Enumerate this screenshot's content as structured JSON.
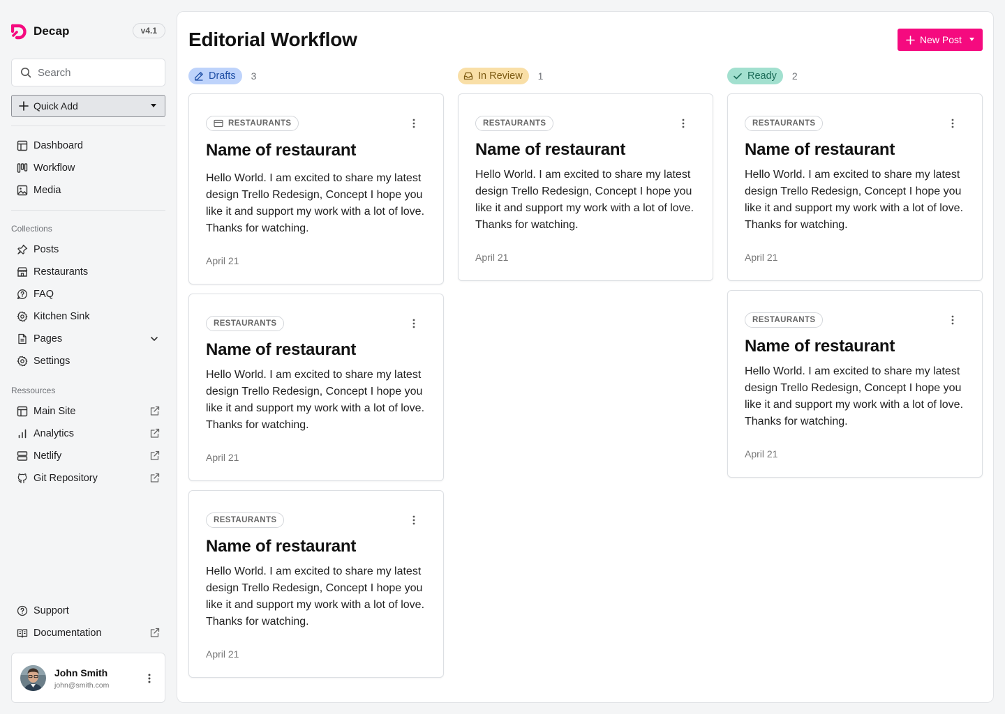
{
  "app": {
    "name": "Decap",
    "version": "v4.1"
  },
  "search": {
    "placeholder": "Search"
  },
  "quick_add": {
    "label": "Quick Add"
  },
  "nav": [
    {
      "label": "Dashboard",
      "icon": "dashboard-icon"
    },
    {
      "label": "Workflow",
      "icon": "workflow-icon"
    },
    {
      "label": "Media",
      "icon": "media-icon"
    }
  ],
  "collections": {
    "label": "Collections",
    "items": [
      {
        "label": "Posts",
        "icon": "pin-icon"
      },
      {
        "label": "Restaurants",
        "icon": "store-icon"
      },
      {
        "label": "FAQ",
        "icon": "faq-icon"
      },
      {
        "label": "Kitchen Sink",
        "icon": "gear-icon"
      },
      {
        "label": "Pages",
        "icon": "page-icon"
      },
      {
        "label": "Settings",
        "icon": "gear-icon"
      }
    ]
  },
  "resources": {
    "label": "Ressources",
    "items": [
      {
        "label": "Main Site",
        "icon": "layout-icon"
      },
      {
        "label": "Analytics",
        "icon": "analytics-icon"
      },
      {
        "label": "Netlify",
        "icon": "server-icon"
      },
      {
        "label": "Git Repository",
        "icon": "github-icon"
      }
    ]
  },
  "footer_nav": [
    {
      "label": "Support",
      "icon": "help-icon"
    },
    {
      "label": "Documentation",
      "icon": "book-icon"
    }
  ],
  "user": {
    "name": "John Smith",
    "email": "john@smith.com"
  },
  "page": {
    "title": "Editorial Workflow",
    "new_post_label": "New Post"
  },
  "columns": [
    {
      "label": "Drafts",
      "count": "3",
      "color": "#bed3fb",
      "cards": [
        {
          "tag": "RESTAURANTS",
          "title": "Name of restaurant",
          "body": "Hello World. I am excited to share my latest design Trello Redesign, Concept I hope you like it and support my work with a lot of love. Thanks for watching.",
          "date": "April 21"
        },
        {
          "tag": "RESTAURANTS",
          "title": "Name of restaurant",
          "body": "Hello World. I am excited to share my latest design Trello Redesign, Concept I hope you like it and support my work with a lot of love. Thanks for watching.",
          "date": "April 21"
        },
        {
          "tag": "RESTAURANTS",
          "title": "Name of restaurant",
          "body": "Hello World. I am excited to share my latest design Trello Redesign, Concept I hope you like it and support my work with a lot of love. Thanks for watching.",
          "date": "April 21"
        }
      ]
    },
    {
      "label": "In Review",
      "count": "1",
      "color": "#f9dfa7",
      "cards": [
        {
          "tag": "RESTAURANTS",
          "title": "Name of restaurant",
          "body": "Hello World. I am excited to share my latest design Trello Redesign, Concept I hope you like it and support my work with a lot of love. Thanks for watching.",
          "date": "April 21"
        }
      ]
    },
    {
      "label": "Ready",
      "count": "2",
      "color": "#a2e0cf",
      "cards": [
        {
          "tag": "RESTAURANTS",
          "title": "Name of restaurant",
          "body": "Hello World. I am excited to share my latest design Trello Redesign, Concept I hope you like it and support my work with a lot of love. Thanks for watching.",
          "date": "April 21"
        },
        {
          "tag": "RESTAURANTS",
          "title": "Name of restaurant",
          "body": "Hello World. I am excited to share my latest design Trello Redesign, Concept I hope you like it and support my work with a lot of love. Thanks for watching.",
          "date": "April 21"
        }
      ]
    }
  ],
  "colors": {
    "accent": "#f50a7f",
    "drafts": "#bed3fb",
    "in_review": "#f9dfa7",
    "ready": "#a2e0cf"
  }
}
